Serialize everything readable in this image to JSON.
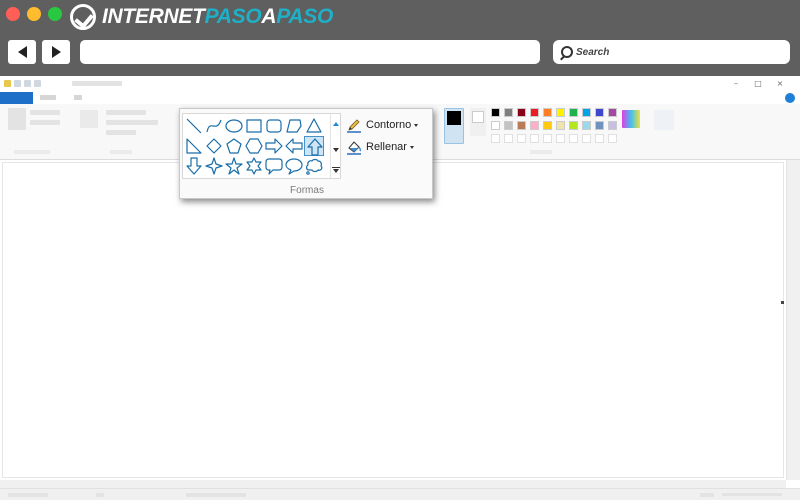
{
  "brand": {
    "part1": "INTERNET",
    "part2": "PASO",
    "part3": "A",
    "part4": "PASO",
    "accent": "#1fb0c7"
  },
  "browser": {
    "search_label": "Search",
    "back_icon": "triangle-left",
    "forward_icon": "triangle-right"
  },
  "paint": {
    "file_tab_color": "#1e6fc7",
    "shapes": [
      {
        "name": "line",
        "row": 0,
        "col": 0
      },
      {
        "name": "curve",
        "row": 0,
        "col": 1
      },
      {
        "name": "oval",
        "row": 0,
        "col": 2
      },
      {
        "name": "rectangle",
        "row": 0,
        "col": 3
      },
      {
        "name": "rounded-rectangle",
        "row": 0,
        "col": 4
      },
      {
        "name": "polygon",
        "row": 0,
        "col": 5
      },
      {
        "name": "triangle",
        "row": 0,
        "col": 6
      },
      {
        "name": "right-triangle",
        "row": 1,
        "col": 0
      },
      {
        "name": "diamond",
        "row": 1,
        "col": 1
      },
      {
        "name": "pentagon",
        "row": 1,
        "col": 2
      },
      {
        "name": "hexagon",
        "row": 1,
        "col": 3
      },
      {
        "name": "right-arrow",
        "row": 1,
        "col": 4
      },
      {
        "name": "left-arrow",
        "row": 1,
        "col": 5
      },
      {
        "name": "up-arrow",
        "row": 1,
        "col": 6,
        "selected": true
      },
      {
        "name": "down-arrow",
        "row": 2,
        "col": 0
      },
      {
        "name": "four-point-star",
        "row": 2,
        "col": 1
      },
      {
        "name": "five-point-star",
        "row": 2,
        "col": 2
      },
      {
        "name": "six-point-star",
        "row": 2,
        "col": 3
      },
      {
        "name": "rounded-callout",
        "row": 2,
        "col": 4
      },
      {
        "name": "oval-callout",
        "row": 2,
        "col": 5
      },
      {
        "name": "cloud-callout",
        "row": 2,
        "col": 6
      }
    ],
    "outline_label": "Contorno",
    "fill_label": "Rellenar",
    "group_label": "Formas",
    "shape_color": "#1a6ea8",
    "palette": [
      "#000000",
      "#7f7f7f",
      "#880015",
      "#ed1c24",
      "#ff7f27",
      "#fff200",
      "#22b14c",
      "#00a2e8",
      "#3f48cc",
      "#a349a4",
      "#ffffff",
      "#c3c3c3",
      "#b97a57",
      "#ffaec9",
      "#ffc90e",
      "#efe4b0",
      "#b5e61d",
      "#99d9ea",
      "#7092be",
      "#c8bfe7"
    ]
  }
}
